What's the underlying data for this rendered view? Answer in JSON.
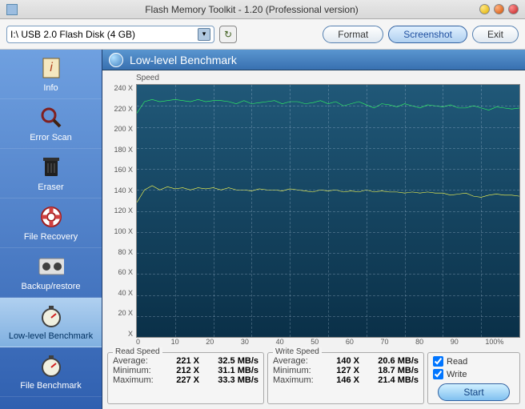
{
  "window": {
    "title": "Flash Memory Toolkit - 1.20 (Professional version)"
  },
  "toolbar": {
    "drive": "I:\\ USB 2.0 Flash Disk (4 GB)",
    "format": "Format",
    "screenshot": "Screenshot",
    "exit": "Exit"
  },
  "sidebar": {
    "items": [
      {
        "label": "Info"
      },
      {
        "label": "Error Scan"
      },
      {
        "label": "Eraser"
      },
      {
        "label": "File Recovery"
      },
      {
        "label": "Backup/restore"
      },
      {
        "label": "Low-level Benchmark"
      },
      {
        "label": "File Benchmark"
      }
    ]
  },
  "panel": {
    "title": "Low-level Benchmark",
    "speed_label": "Speed"
  },
  "chart_data": {
    "type": "line",
    "title": "Low-level Benchmark",
    "xlabel": "",
    "ylabel": "Speed",
    "yticks": [
      "240 X",
      "220 X",
      "200 X",
      "180 X",
      "160 X",
      "140 X",
      "120 X",
      "100 X",
      "80 X",
      "60 X",
      "40 X",
      "20 X",
      "X"
    ],
    "xticks": [
      "0",
      "10",
      "20",
      "30",
      "40",
      "50",
      "60",
      "70",
      "80",
      "90",
      "100%"
    ],
    "ylim": [
      0,
      240
    ],
    "xlim": [
      0,
      100
    ],
    "series": [
      {
        "name": "Read",
        "color": "#30ff60",
        "x": [
          0,
          2,
          4,
          6,
          8,
          10,
          12,
          14,
          16,
          18,
          20,
          22,
          24,
          26,
          28,
          30,
          32,
          34,
          36,
          38,
          40,
          42,
          44,
          46,
          48,
          50,
          52,
          54,
          56,
          58,
          60,
          62,
          64,
          66,
          68,
          70,
          72,
          74,
          76,
          78,
          80,
          82,
          84,
          86,
          88,
          90,
          92,
          94,
          96,
          98,
          100
        ],
        "values": [
          213,
          224,
          226,
          224,
          225,
          226,
          225,
          224,
          226,
          224,
          225,
          225,
          224,
          222,
          225,
          222,
          223,
          224,
          225,
          222,
          224,
          224,
          222,
          223,
          225,
          222,
          224,
          220,
          222,
          224,
          221,
          218,
          222,
          221,
          219,
          222,
          220,
          218,
          221,
          220,
          219,
          221,
          218,
          218,
          220,
          218,
          216,
          219,
          218,
          217,
          218
        ]
      },
      {
        "name": "Write",
        "color": "#ffff50",
        "x": [
          0,
          2,
          4,
          6,
          8,
          10,
          12,
          14,
          16,
          18,
          20,
          22,
          24,
          26,
          28,
          30,
          32,
          34,
          36,
          38,
          40,
          42,
          44,
          46,
          48,
          50,
          52,
          54,
          56,
          58,
          60,
          62,
          64,
          66,
          68,
          70,
          72,
          74,
          76,
          78,
          80,
          82,
          84,
          86,
          88,
          90,
          92,
          94,
          96,
          98,
          100
        ],
        "values": [
          128,
          140,
          144,
          140,
          143,
          141,
          142,
          140,
          142,
          141,
          142,
          140,
          142,
          140,
          140,
          139,
          141,
          140,
          140,
          139,
          141,
          140,
          139,
          138,
          140,
          139,
          140,
          138,
          139,
          138,
          140,
          138,
          139,
          138,
          138,
          137,
          138,
          137,
          138,
          137,
          137,
          135,
          136,
          137,
          134,
          133,
          135,
          136,
          135,
          135,
          134
        ]
      }
    ]
  },
  "read": {
    "legend": "Read Speed",
    "avg_lbl": "Average:",
    "avg_x": "221 X",
    "avg_v": "32.5 MB/s",
    "min_lbl": "Minimum:",
    "min_x": "212 X",
    "min_v": "31.1 MB/s",
    "max_lbl": "Maximum:",
    "max_x": "227 X",
    "max_v": "33.3 MB/s"
  },
  "write": {
    "legend": "Write Speed",
    "avg_lbl": "Average:",
    "avg_x": "140 X",
    "avg_v": "20.6 MB/s",
    "min_lbl": "Minimum:",
    "min_x": "127 X",
    "min_v": "18.7 MB/s",
    "max_lbl": "Maximum:",
    "max_x": "146 X",
    "max_v": "21.4 MB/s"
  },
  "options": {
    "read": "Read",
    "write": "Write",
    "start": "Start"
  }
}
